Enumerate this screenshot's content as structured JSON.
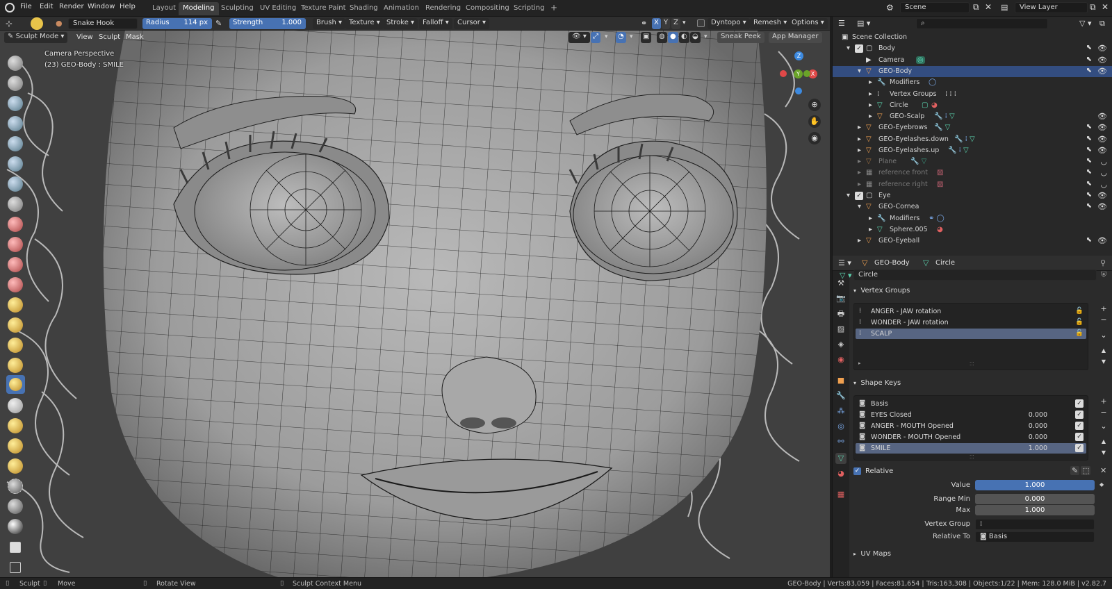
{
  "topbar": {
    "menus": [
      "File",
      "Edit",
      "Render",
      "Window",
      "Help"
    ],
    "workspaces": [
      "Layout",
      "Modeling",
      "Sculpting",
      "UV Editing",
      "Texture Paint",
      "Shading",
      "Animation",
      "Rendering",
      "Compositing",
      "Scripting"
    ],
    "active_workspace": "Modeling",
    "add_tab": "+",
    "scene": "Scene",
    "view_layer": "View Layer"
  },
  "tool_header": {
    "brush_name": "Snake Hook",
    "radius_label": "Radius",
    "radius_value": "114 px",
    "strength_label": "Strength",
    "strength_value": "1.000",
    "menus": [
      "Brush",
      "Texture",
      "Stroke",
      "Falloff",
      "Cursor"
    ],
    "axes": [
      "X",
      "Y",
      "Z"
    ],
    "dyntopo": "Dyntopo",
    "remesh": "Remesh",
    "options": "Options"
  },
  "viewport_header": {
    "mode": "Sculpt Mode",
    "menus": [
      "View",
      "Sculpt",
      "Mask"
    ],
    "sneak_peek": "Sneak Peek",
    "app_manager": "App Manager"
  },
  "viewport": {
    "perspective": "Camera Perspective",
    "object_info": "(23) GEO-Body : SMILE",
    "gizmo_axes": {
      "x": "X",
      "y": "Y",
      "z": "Z"
    }
  },
  "outliner": {
    "search_placeholder": "",
    "root": "Scene Collection",
    "rows": [
      {
        "label": "Body",
        "type": "collection"
      },
      {
        "label": "Camera",
        "type": "camera"
      },
      {
        "label": "GEO-Body",
        "type": "mesh"
      },
      {
        "label": "Modifiers",
        "type": "modifier"
      },
      {
        "label": "Vertex Groups",
        "type": "vgroup"
      },
      {
        "label": "Circle",
        "type": "data"
      },
      {
        "label": "GEO-Scalp",
        "type": "mesh"
      },
      {
        "label": "GEO-Eyebrows",
        "type": "mesh"
      },
      {
        "label": "GEO-Eyelashes.down",
        "type": "mesh"
      },
      {
        "label": "GEO-Eyelashes.up",
        "type": "mesh"
      },
      {
        "label": "Plane",
        "type": "mesh"
      },
      {
        "label": "reference front",
        "type": "image"
      },
      {
        "label": "reference right",
        "type": "image"
      },
      {
        "label": "Eye",
        "type": "collection"
      },
      {
        "label": "GEO-Cornea",
        "type": "mesh"
      },
      {
        "label": "Modifiers",
        "type": "modifier"
      },
      {
        "label": "Sphere.005",
        "type": "data"
      },
      {
        "label": "GEO-Eyeball",
        "type": "mesh"
      }
    ]
  },
  "properties": {
    "breadcrumb_object": "GEO-Body",
    "breadcrumb_data": "Circle",
    "data_name": "Circle",
    "vertex_groups_title": "Vertex Groups",
    "vertex_groups": [
      "ANGER - JAW rotation",
      "WONDER - JAW rotation",
      "SCALP"
    ],
    "shape_keys_title": "Shape Keys",
    "shape_keys": [
      {
        "name": "Basis",
        "value": ""
      },
      {
        "name": "EYES Closed",
        "value": "0.000"
      },
      {
        "name": "ANGER - MOUTH Opened",
        "value": "0.000"
      },
      {
        "name": "WONDER - MOUTH Opened",
        "value": "0.000"
      },
      {
        "name": "SMILE",
        "value": "1.000"
      }
    ],
    "relative_label": "Relative",
    "value_label": "Value",
    "value": "1.000",
    "range_min_label": "Range Min",
    "range_min": "0.000",
    "max_label": "Max",
    "max": "1.000",
    "vertex_group_label": "Vertex Group",
    "vertex_group_value": "",
    "relative_to_label": "Relative To",
    "relative_to_value": "Basis",
    "uv_maps_title": "UV Maps"
  },
  "statusbar": {
    "left": [
      "Sculpt",
      "Move",
      "Rotate View",
      "Sculpt Context Menu"
    ],
    "stats": "GEO-Body | Verts:83,059 | Faces:81,654 | Tris:163,308 | Objects:1/22 | Mem: 128.0 MiB | v2.82.7"
  },
  "colors": {
    "accent": "#4772b3",
    "selected_row": "#334d80",
    "x_axis": "#e04848",
    "y_axis": "#6aa329",
    "z_axis": "#3d8ae0"
  }
}
